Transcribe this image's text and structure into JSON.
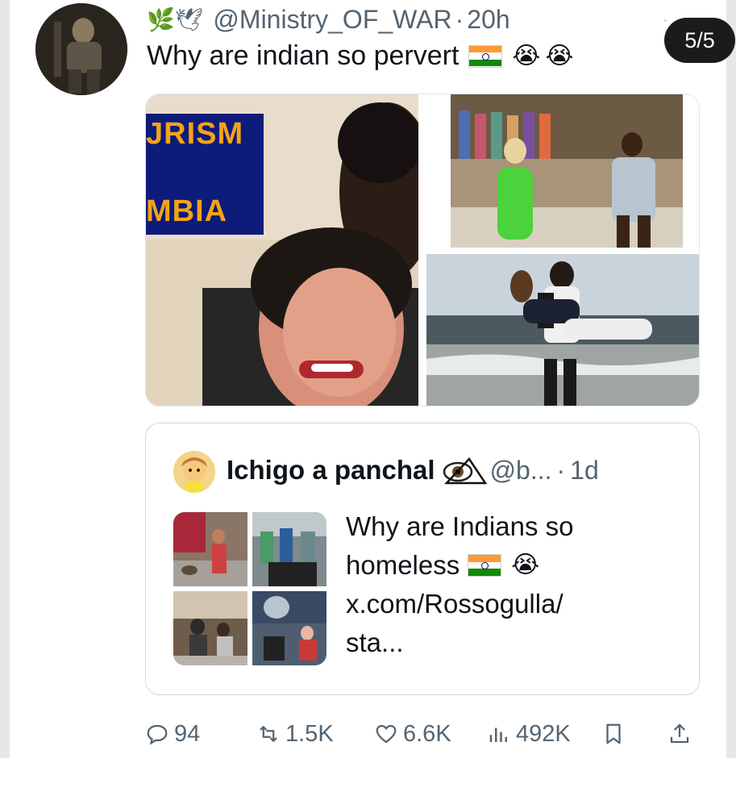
{
  "tweet": {
    "header_emojis": "🌿🕊",
    "handle": "@Ministry_OF_WAR",
    "separator": "·",
    "time": "20h",
    "text": "Why are indian so pervert",
    "page_indicator": "5/5"
  },
  "media": {
    "banner_line1": "JRISM",
    "banner_line2": "MBIA"
  },
  "quote": {
    "name": "Ichigo a panchal",
    "handle": "@b...",
    "separator": "·",
    "time": "1d",
    "line1": "Why are Indians so",
    "line2": "homeless",
    "line3": "x.com/Rossogulla/",
    "line4": "sta..."
  },
  "actions": {
    "replies": "94",
    "reposts": "1.5K",
    "likes": "6.6K",
    "views": "492K"
  },
  "colors": {
    "text": "#0f1419",
    "secondary": "#536471",
    "border": "#cfd9de",
    "pill": "#1b1b1b"
  }
}
